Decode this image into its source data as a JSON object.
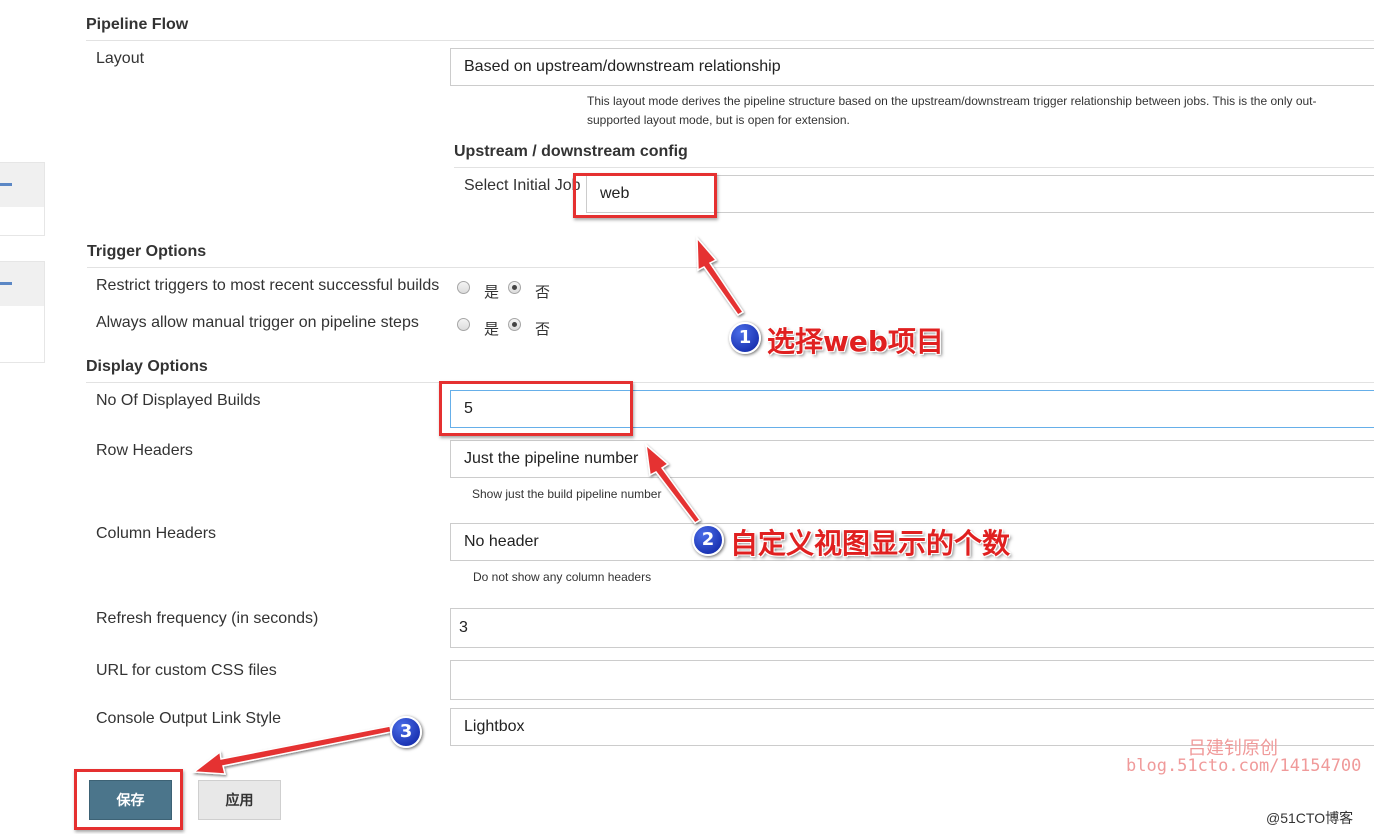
{
  "sections": {
    "pipeline_flow": "Pipeline Flow",
    "upstream_config": "Upstream / downstream config",
    "trigger_options": "Trigger Options",
    "display_options": "Display Options"
  },
  "layout": {
    "label": "Layout",
    "value": "Based on upstream/downstream relationship",
    "help_line1": "This layout mode derives the pipeline structure based on the upstream/downstream trigger relationship between jobs. This is the only out-",
    "help_line2": "supported layout mode, but is open for extension."
  },
  "initial_job": {
    "label": "Select Initial Job",
    "value": "web"
  },
  "triggers": {
    "restrict_label": "Restrict triggers to most recent successful builds",
    "manual_label": "Always allow manual trigger on pipeline steps",
    "yes": "是",
    "no": "否"
  },
  "display": {
    "builds_label": "No Of Displayed Builds",
    "builds_value": "5",
    "row_headers_label": "Row Headers",
    "row_headers_value": "Just the pipeline number",
    "row_headers_help": "Show just the build pipeline number",
    "column_headers_label": "Column Headers",
    "column_headers_value": "No header",
    "column_headers_help": "Do not show any column headers",
    "refresh_label": "Refresh frequency (in seconds)",
    "refresh_value": "3",
    "css_label": "URL for custom CSS files",
    "css_value": "",
    "console_label": "Console Output Link Style",
    "console_value": "Lightbox"
  },
  "buttons": {
    "save": "保存",
    "apply": "应用"
  },
  "annotations": {
    "badge1": "1",
    "text1": "选择web项目",
    "badge2": "2",
    "text2": "自定义视图显示的个数",
    "badge3": "3"
  },
  "watermark": {
    "author": "吕建钊原创",
    "url": "blog.51cto.com/14154700",
    "corner": "@51CTO博客"
  },
  "colors": {
    "annotation_red": "#e53030",
    "save_button": "#4b758b",
    "badge_blue": "#1a33c0"
  }
}
